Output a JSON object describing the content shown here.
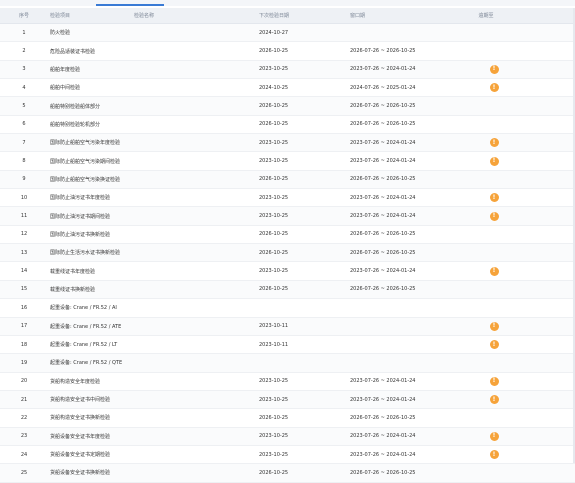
{
  "header": {
    "idx": "序号",
    "name": "检验项目",
    "category": "检验名称",
    "next_date": "下次检验日期",
    "window": "窗口期",
    "overdue": "逾期至"
  },
  "rows": [
    {
      "idx": "1",
      "name": "防火检验",
      "date": "2024-10-27",
      "range": "",
      "warn": false
    },
    {
      "idx": "2",
      "name": "危险品适装证书检验",
      "date": "2026-10-25",
      "range": "2026-07-26 ~ 2026-10-25",
      "warn": false
    },
    {
      "idx": "3",
      "name": "船舶年度检验",
      "date": "2023-10-25",
      "range": "2023-07-26 ~ 2024-01-24",
      "warn": true
    },
    {
      "idx": "4",
      "name": "船舶中间检验",
      "date": "2024-10-25",
      "range": "2024-07-26 ~ 2025-01-24",
      "warn": true
    },
    {
      "idx": "5",
      "name": "船舶特别检验船体部分",
      "date": "2026-10-25",
      "range": "2026-07-26 ~ 2026-10-25",
      "warn": false
    },
    {
      "idx": "6",
      "name": "船舶特别检验轮机部分",
      "date": "2026-10-25",
      "range": "2026-07-26 ~ 2026-10-25",
      "warn": false
    },
    {
      "idx": "7",
      "name": "国际防止船舶空气污染年度检验",
      "date": "2023-10-25",
      "range": "2023-07-26 ~ 2024-01-24",
      "warn": true
    },
    {
      "idx": "8",
      "name": "国际防止船舶空气污染期间检验",
      "date": "2023-10-25",
      "range": "2023-07-26 ~ 2024-01-24",
      "warn": true
    },
    {
      "idx": "9",
      "name": "国际防止船舶空气污染换证检验",
      "date": "2026-10-25",
      "range": "2026-07-26 ~ 2026-10-25",
      "warn": false
    },
    {
      "idx": "10",
      "name": "国际防止油污证书年度检验",
      "date": "2023-10-25",
      "range": "2023-07-26 ~ 2024-01-24",
      "warn": true
    },
    {
      "idx": "11",
      "name": "国际防止油污证书期间检验",
      "date": "2023-10-25",
      "range": "2023-07-26 ~ 2024-01-24",
      "warn": true
    },
    {
      "idx": "12",
      "name": "国际防止油污证书换新检验",
      "date": "2026-10-25",
      "range": "2026-07-26 ~ 2026-10-25",
      "warn": false
    },
    {
      "idx": "13",
      "name": "国际防止生活污水证书换新检验",
      "date": "2026-10-25",
      "range": "2026-07-26 ~ 2026-10-25",
      "warn": false
    },
    {
      "idx": "14",
      "name": "载重线证书年度检验",
      "date": "2023-10-25",
      "range": "2023-07-26 ~ 2024-01-24",
      "warn": true
    },
    {
      "idx": "15",
      "name": "载重线证书换新检验",
      "date": "2026-10-25",
      "range": "2026-07-26 ~ 2026-10-25",
      "warn": false
    },
    {
      "idx": "16",
      "name": "起重设备: Crane / FR.52 / AI",
      "date": "",
      "range": "",
      "warn": false
    },
    {
      "idx": "17",
      "name": "起重设备: Crane / FR.52 / ATE",
      "date": "2023-10-11",
      "range": "",
      "warn": true
    },
    {
      "idx": "18",
      "name": "起重设备: Crane / FR.52 / LT",
      "date": "2023-10-11",
      "range": "",
      "warn": true
    },
    {
      "idx": "19",
      "name": "起重设备: Crane / FR.52 / QTE",
      "date": "",
      "range": "",
      "warn": false
    },
    {
      "idx": "20",
      "name": "货船构造安全年度检验",
      "date": "2023-10-25",
      "range": "2023-07-26 ~ 2024-01-24",
      "warn": true
    },
    {
      "idx": "21",
      "name": "货船构造安全证书中间检验",
      "date": "2023-10-25",
      "range": "2023-07-26 ~ 2024-01-24",
      "warn": true
    },
    {
      "idx": "22",
      "name": "货船构造安全证书换新检验",
      "date": "2026-10-25",
      "range": "2026-07-26 ~ 2026-10-25",
      "warn": false
    },
    {
      "idx": "23",
      "name": "货船设备安全证书年度检验",
      "date": "2023-10-25",
      "range": "2023-07-26 ~ 2024-01-24",
      "warn": true
    },
    {
      "idx": "24",
      "name": "货船设备安全证书定期检验",
      "date": "2023-10-25",
      "range": "2023-07-26 ~ 2024-01-24",
      "warn": true
    },
    {
      "idx": "25",
      "name": "货船设备安全证书换新检验",
      "date": "2026-10-25",
      "range": "2026-07-26 ~ 2026-10-25",
      "warn": false
    }
  ],
  "colors": {
    "accent": "#3a7bd5",
    "warn": "#f6a33a"
  },
  "icons": {
    "warn": "warning-badge-icon"
  }
}
